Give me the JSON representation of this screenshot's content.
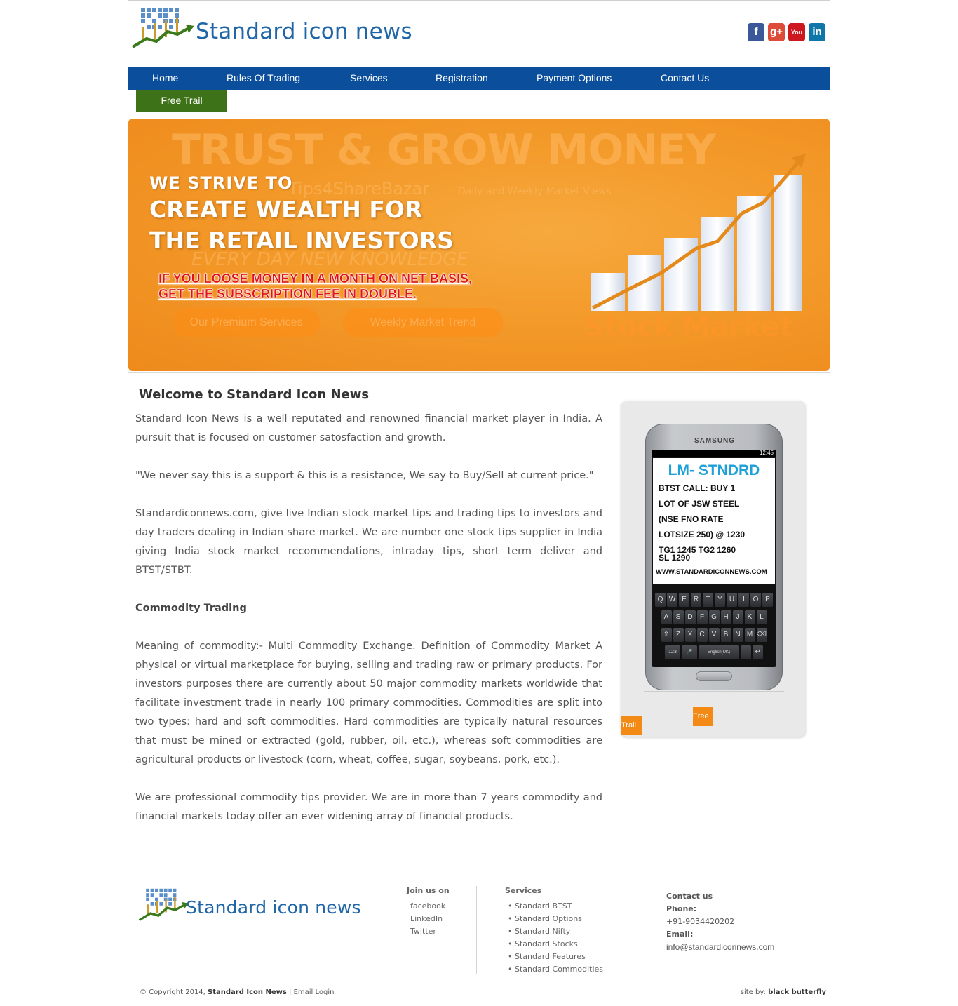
{
  "header": {
    "logo_text": "Standard icon news",
    "social": [
      {
        "icon": "facebook-icon",
        "glyph": "f",
        "color": "#3b5998"
      },
      {
        "icon": "google-plus-icon",
        "glyph": "g+",
        "color": "#dd4b39"
      },
      {
        "icon": "youtube-icon",
        "glyph": "You",
        "color": "#cc181e"
      },
      {
        "icon": "linkedin-icon",
        "glyph": "in",
        "color": "#0e76a8"
      }
    ]
  },
  "nav": {
    "items": [
      "Home",
      "Rules Of Trading",
      "Services",
      "Registration",
      "Payment Options",
      "Contact Us"
    ],
    "free_trail": "Free Trail",
    "bar_color": "#0b4f9c",
    "free_trail_color": "#3e7218"
  },
  "banner": {
    "ghost_title": "TRUST & GROW MONEY",
    "ghost_brand": "Tips4ShareBazar",
    "ghost_sub": "Daily and Weekly Market Views",
    "ghost_knowledge": "EVERY DAY NEW KNOWLEDGE",
    "line1": "WE STRIVE TO",
    "line2": "CREATE WEALTH FOR",
    "line3": "THE RETAIL INVESTORS",
    "red1": "IF YOU LOOSE MONEY IN A MONTH ON NET BASIS,",
    "red2": "GET THE SUBSCRIPTION FEE IN DOUBLE.",
    "pill1": "Our Premium Services",
    "pill2": "Weekly Market Trend",
    "ghost_stock": "Stock Market"
  },
  "main": {
    "title": "Welcome to Standard Icon News",
    "para1": "Standard Icon News is a well reputated and renowned financial market player in India. A pursuit that is focused on customer satosfaction and growth.",
    "para2": "\"We never say this is a support & this is a resistance, We say to Buy/Sell at current price.\"",
    "para3": "Standardiconnews.com, give live Indian stock market tips and trading tips to investors and day traders dealing in Indian share market. We are number one stock tips supplier in India giving India stock market recommendations, intraday tips, short term deliver and BTST/STBT.",
    "subheading": "Commodity Trading",
    "para4": "Meaning of commodity:- Multi Commodity Exchange. Definition of Commodity Market A physical or virtual marketplace for buying, selling and trading raw or primary products. For investors purposes there are currently about 50 major commodity markets worldwide that facilitate investment trade in nearly 100 primary commodities. Commodities are split into two types: hard and soft commodities. Hard commodities are typically natural resources that must be mined or extracted (gold, rubber, oil, etc.), whereas soft commodities are agricultural products or livestock (corn, wheat, coffee, sugar, soybeans, pork, etc.).",
    "para5": "We are professional commodity tips provider. We are in more than 7 years commodity and financial markets today offer an ever widening array of financial products."
  },
  "phone": {
    "brand": "SAMSUNG",
    "time": "12:45",
    "sms_head": "LM- STNDRD",
    "sms_lines": [
      "BTST CALL: BUY 1",
      "LOT OF JSW STEEL",
      "(NSE FNO RATE",
      "LOTSIZE 250) @ 1230",
      "TG1 1245 TG2 1260",
      "SL 1290",
      "WWW.STANDARDICONNEWS.COM"
    ],
    "keys_row1": [
      "Q",
      "W",
      "E",
      "R",
      "T",
      "Y",
      "U",
      "I",
      "O",
      "P"
    ],
    "keys_row2": [
      "A",
      "S",
      "D",
      "F",
      "G",
      "H",
      "J",
      "K",
      "L"
    ],
    "keys_row3": [
      "⇧",
      "Z",
      "X",
      "C",
      "V",
      "B",
      "N",
      "M",
      "⌫"
    ],
    "keys_row4": [
      "123",
      "🎤",
      "English(UK)",
      ".",
      "↵"
    ],
    "free": "Free",
    "trail": "Trail"
  },
  "footer": {
    "logo_text": "Standard icon news",
    "join_title": "Join us on",
    "join_links": [
      "facebook",
      "LinkedIn",
      "Twitter"
    ],
    "services_title": "Services",
    "services_links": [
      "• Standard BTST",
      "• Standard Options",
      "• Standard Nifty",
      "• Standard Stocks",
      "• Standard Features",
      "• Standard Commodities"
    ],
    "contact_title": "Contact us",
    "phone_label": "Phone:",
    "phone_value": "+91-9034420202",
    "email_label": "Email:",
    "email_value": "info@standardiconnews.com",
    "copyright_prefix": "© Copyright 2014,",
    "copyright_brand": "Standard Icon News",
    "copyright_sep": "|",
    "email_login": "Email Login",
    "credit_prefix": "site by:",
    "credit_name": "black butterfly"
  }
}
